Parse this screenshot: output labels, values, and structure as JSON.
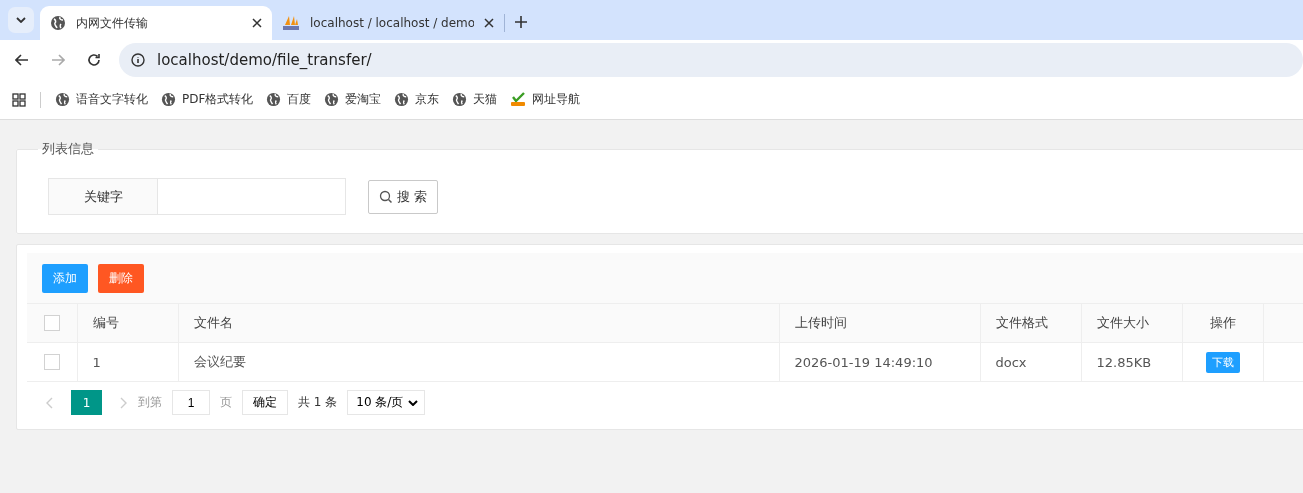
{
  "browser": {
    "tabs": [
      {
        "title": "内网文件传输",
        "selected": true,
        "kind": "site"
      },
      {
        "title": "localhost / localhost / demo",
        "selected": false,
        "kind": "admin"
      }
    ],
    "url": "localhost/demo/file_transfer/",
    "bookmarks": [
      {
        "label": "语音文字转化",
        "kind": "site"
      },
      {
        "label": "PDF格式转化",
        "kind": "site"
      },
      {
        "label": "百度",
        "kind": "site"
      },
      {
        "label": "爱淘宝",
        "kind": "site"
      },
      {
        "label": "京东",
        "kind": "site"
      },
      {
        "label": "天猫",
        "kind": "site"
      },
      {
        "label": "网址导航",
        "kind": "directory"
      }
    ]
  },
  "search_panel": {
    "legend": "列表信息",
    "field_label": "关键字",
    "button": "搜 索"
  },
  "toolbar": [
    {
      "label": "添加",
      "kind": "primary"
    },
    {
      "label": "删除",
      "kind": "danger"
    }
  ],
  "table": {
    "header_checked": false,
    "columns": [
      "编号",
      "文件名",
      "上传时间",
      "文件格式",
      "文件大小",
      "操作"
    ],
    "rows": [
      {
        "checked": false,
        "cells": [
          "1",
          "会议纪要",
          "2026-01-19 14:49:10",
          "docx",
          "12.85KB"
        ],
        "action": "下载"
      }
    ]
  },
  "pagination": {
    "current": "1",
    "goto_label": "到第",
    "page_value": "1",
    "page_unit": "页",
    "confirm": "确定",
    "total": "共 1 条",
    "page_size": "10 条/页"
  }
}
